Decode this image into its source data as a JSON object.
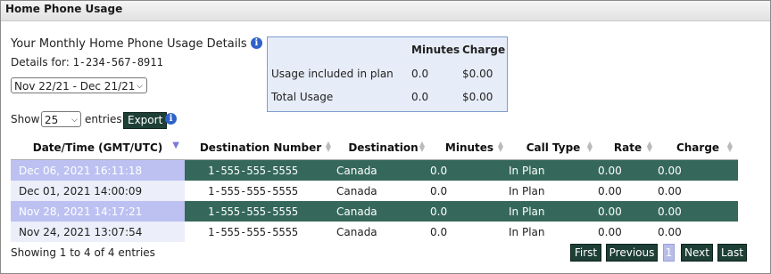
{
  "panel": {
    "title": "Home Phone Usage"
  },
  "section": {
    "title": "Your Monthly Home Phone Usage Details",
    "details_label": "Details for:",
    "phone": "1-234-567-8911",
    "period": "Nov 22/21 - Dec 21/21"
  },
  "summary": {
    "headers": {
      "minutes": "Minutes",
      "charge": "Charge"
    },
    "rows": [
      {
        "label": "Usage included in plan",
        "minutes": "0.0",
        "charge": "$0.00"
      },
      {
        "label": "Total Usage",
        "minutes": "0.0",
        "charge": "$0.00"
      }
    ]
  },
  "controls": {
    "show_label": "Show",
    "page_size": "25",
    "entries_label": "entries",
    "export_label": "Export"
  },
  "table": {
    "columns": [
      "Date/Time (GMT/UTC)",
      "Destination Number",
      "Destination",
      "Minutes",
      "Call Type",
      "Rate",
      "Charge"
    ],
    "rows": [
      [
        "Dec 06, 2021 16:11:18",
        "1-555-555-5555",
        "Canada",
        "0.0",
        "In Plan",
        "0.00",
        "0.00"
      ],
      [
        "Dec 01, 2021 14:00:09",
        "1-555-555-5555",
        "Canada",
        "0.0",
        "In Plan",
        "0.00",
        "0.00"
      ],
      [
        "Nov 28, 2021 14:17:21",
        "1-555-555-5555",
        "Canada",
        "0.0",
        "In Plan",
        "0.00",
        "0.00"
      ],
      [
        "Nov 24, 2021 13:07:54",
        "1-555-555-5555",
        "Canada",
        "0.0",
        "In Plan",
        "0.00",
        "0.00"
      ]
    ]
  },
  "footer": {
    "showing": "Showing 1 to 4 of 4 entries",
    "first": "First",
    "previous": "Previous",
    "page": "1",
    "next": "Next",
    "last": "Last"
  },
  "colors": {
    "row_dark": "#35685a",
    "row_dark_date": "#bcc1f2",
    "button": "#1e3f36",
    "summary_bg": "#e7edf8",
    "info": "#2f62c9"
  }
}
